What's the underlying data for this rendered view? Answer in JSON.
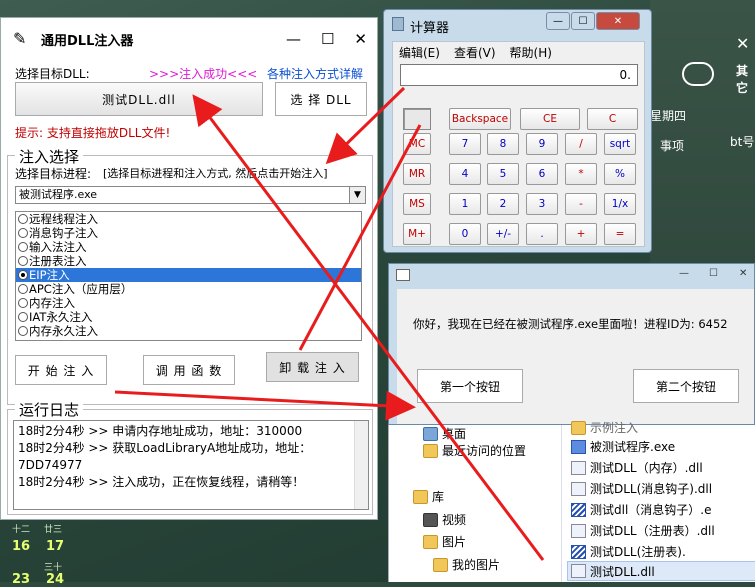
{
  "injector": {
    "title": "通用DLL注入器",
    "select_dll_label": "选择目标DLL:",
    "success_text": ">>>注入成功<<<",
    "methods_link": "各种注入方式详解",
    "dll_button": "测试DLL.dll",
    "choose_dll_button": "选 择 DLL",
    "tip": "提示: 支持直接拖放DLL文件!",
    "group_title": "注入选择",
    "process_label": "选择目标进程:",
    "process_hint": "[选择目标进程和注入方式, 然后点击开始注入]",
    "process_value": "被测试程序.exe",
    "methods": [
      "远程线程注入",
      "消息钩子注入",
      "输入法注入",
      "注册表注入",
      "EIP注入",
      "APC注入（应用层）",
      "内存注入",
      "IAT永久注入",
      "内存永久注入"
    ],
    "selected_method_index": 4,
    "buttons": {
      "start": "开 始 注 入",
      "call": "调 用 函 数",
      "unload": "卸 载 注 入"
    },
    "log_title": "运行日志",
    "log_lines": [
      "18时2分4秒 >> 申请内存地址成功，地址：310000",
      "18时2分4秒 >> 获取LoadLibraryA地址成功，地址：",
      "7DD74977",
      "18时2分4秒 >> 注入成功，正在恢复线程，请稍等！"
    ]
  },
  "calculator": {
    "title": "计算器",
    "menu": [
      "编辑(E)",
      "查看(V)",
      "帮助(H)"
    ],
    "display": "0.",
    "row0": [
      "Backspace",
      "CE",
      "C"
    ],
    "rows": [
      [
        "MC",
        "7",
        "8",
        "9",
        "/",
        "sqrt"
      ],
      [
        "MR",
        "4",
        "5",
        "6",
        "*",
        "%"
      ],
      [
        "MS",
        "1",
        "2",
        "3",
        "-",
        "1/x"
      ],
      [
        "M+",
        "0",
        "+/-",
        ".",
        "+",
        "="
      ]
    ]
  },
  "message_box": {
    "text": "你好，我现在已经在被测试程序.exe里面啦！进程ID为: 6452",
    "button1": "第一个按钮",
    "button2": "第二个按钮"
  },
  "explorer": {
    "left_items": [
      "桌面",
      "最近访问的位置",
      "库",
      "视频",
      "图片",
      "我的图片"
    ],
    "right_items": [
      "示例注入",
      "被测试程序.exe",
      "测试DLL（内存）.dll",
      "测试DLL(消息钩子).dll",
      "测试dll（消息钩子）.e",
      "测试DLL（注册表）.dll",
      "测试DLL(注册表).",
      "测试DLL.dll"
    ]
  },
  "desktop": {
    "right_texts": [
      "其它",
      "星期四",
      "事项",
      "bt号"
    ],
    "calendar_small": [
      "十二",
      "廿三",
      "三十"
    ],
    "calendar_nums": [
      "16",
      "17",
      "23",
      "24"
    ]
  },
  "colors": {
    "arrow": "#e81c1c",
    "selection": "#2b76d8",
    "success": "#e01ad4",
    "link": "#0a4fd6"
  }
}
